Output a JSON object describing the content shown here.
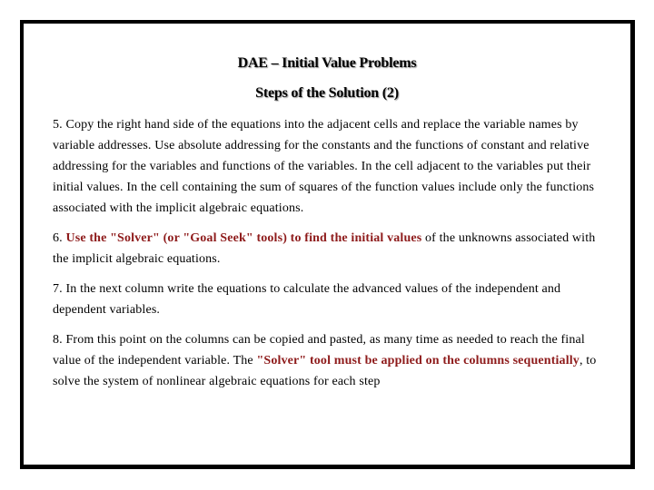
{
  "slide": {
    "title": "DAE – Initial Value Problems",
    "subtitle": "Steps of the Solution (2)",
    "accent_color": "#8e1b1b",
    "steps": [
      {
        "number": "5.",
        "text": "Copy the right hand side of the equations into the adjacent cells and replace the variable names by variable addresses. Use absolute addressing for the constants and the functions of constant and relative addressing for the variables and functions of the variables. In the cell adjacent to the variables put their initial values. In the cell containing the sum of squares of the function values include only the functions associated with the implicit algebraic equations."
      },
      {
        "number": "6.",
        "highlight": "Use the \"Solver\" (or \"Goal Seek\" tools) to find the initial values",
        "text_after": "of the unknowns associated with the implicit algebraic equations."
      },
      {
        "number": "7.",
        "text": "In the next column write the equations to calculate the advanced values of the independent and dependent variables."
      },
      {
        "number": "8.",
        "text_before": "From this point on the columns can be copied and pasted, as many time as needed to reach the final value of the independent variable. The",
        "highlight": "\"Solver\" tool must be applied on the columns sequentially",
        "text_after": ",  to solve the system of nonlinear algebraic equations for each step"
      }
    ]
  }
}
